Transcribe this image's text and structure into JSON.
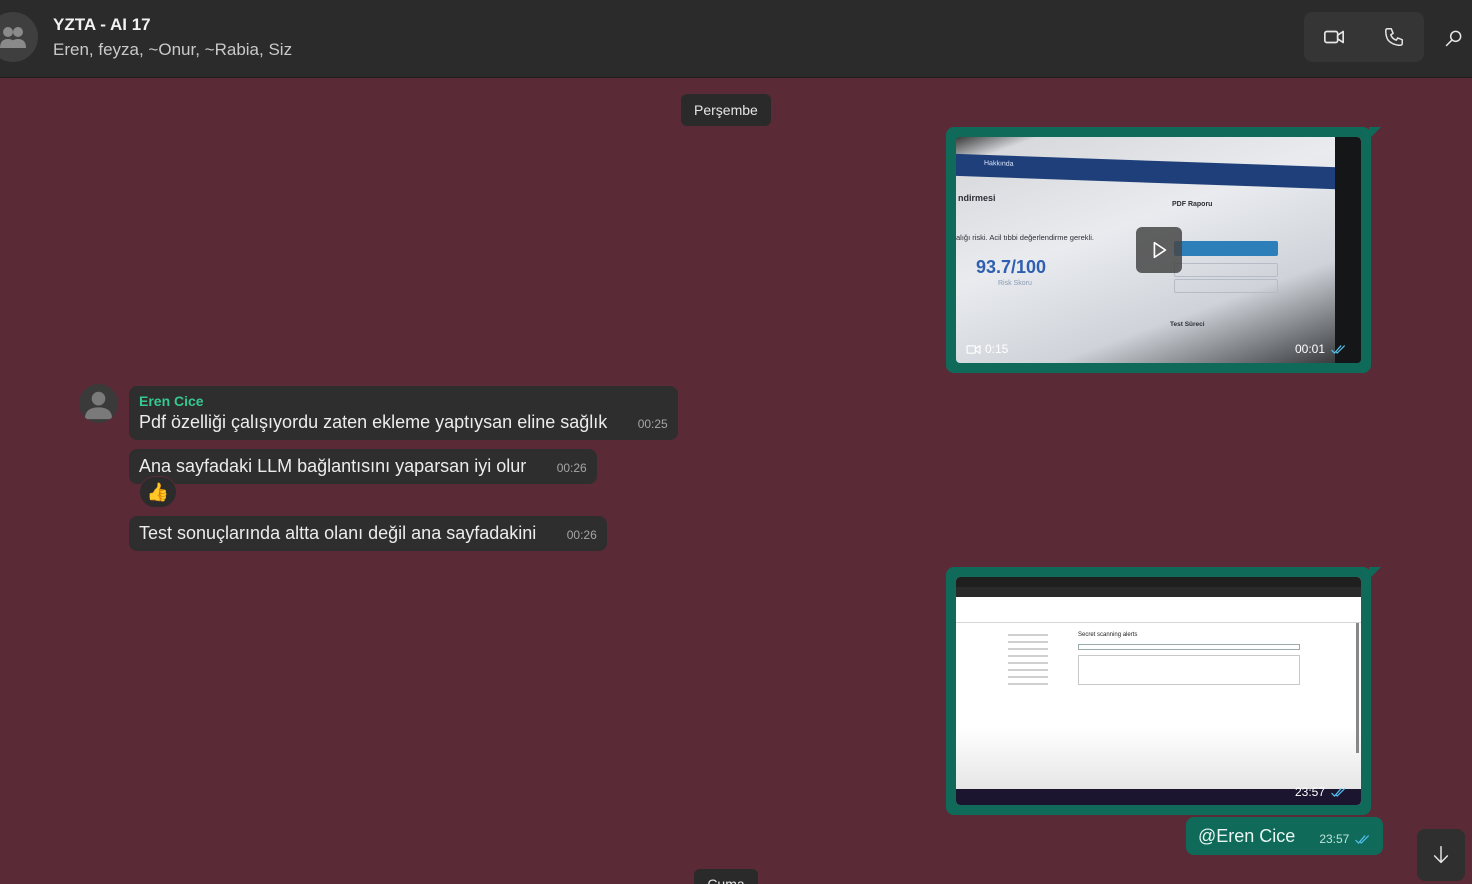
{
  "header": {
    "title": "YZTA - AI 17",
    "members": "Eren, feyza, ~Onur, ~Rabia, Siz",
    "avatar_icon": "group-icon",
    "video_call_icon": "video-camera-icon",
    "voice_call_icon": "phone-icon",
    "search_icon": "search-icon"
  },
  "chat": {
    "date_separator_top": "Perşembe",
    "date_separator_bottom": "Cuma",
    "video_message": {
      "duration": "0:15",
      "time": "00:01",
      "status": "read",
      "thumb_text": {
        "tab": "Hakkında",
        "heading": "ndirmesi",
        "risk": "alığı riski. Acil tıbbi değerlendirme gerekli.",
        "score": "93.7/100",
        "score_label": "Risk Skoru",
        "pdf_title": "PDF Raporu",
        "test_title": "Test Süreci"
      }
    },
    "incoming": {
      "sender": "Eren Cice",
      "messages": [
        {
          "text": "Pdf özelliği çalışıyordu zaten ekleme yaptıysan eline sağlık",
          "time": "00:25"
        },
        {
          "text": "Ana sayfadaki LLM bağlantısını yaparsan iyi olur",
          "time": "00:26",
          "reaction": "👍"
        },
        {
          "text": "Test sonuçlarında altta olanı değil ana sayfadakini",
          "time": "00:26"
        }
      ]
    },
    "image_message": {
      "time": "23:57",
      "status": "read",
      "thumb_text": {
        "heading": "Secret scanning alerts"
      }
    },
    "outgoing_text": {
      "text": "@Eren Cice",
      "time": "23:57",
      "status": "read"
    }
  },
  "colors": {
    "chat_background": "#5a2a36",
    "outgoing_bubble": "#0f6a5a",
    "incoming_bubble": "#2e2e2e",
    "sender_name": "#34c990",
    "read_ticks": "#53bdeb"
  }
}
